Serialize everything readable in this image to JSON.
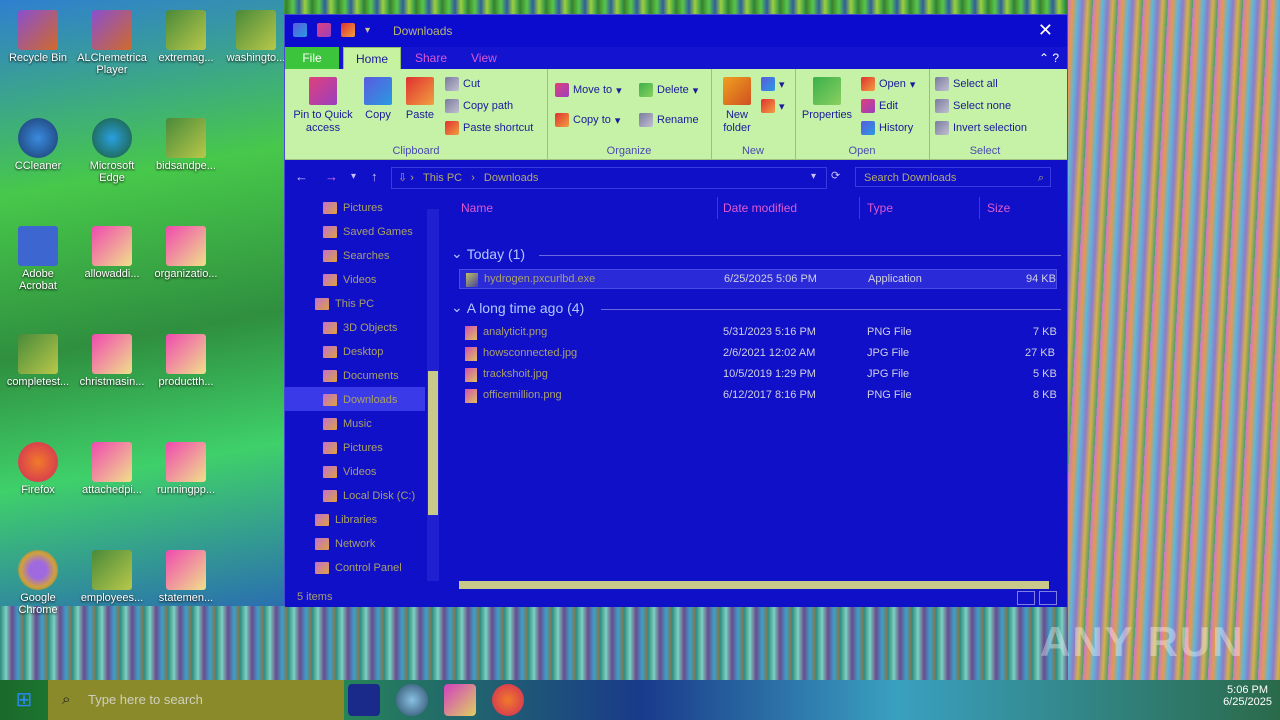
{
  "desktop": {
    "icons": [
      {
        "label": "Recycle Bin",
        "icon": "recycle-bin-icon"
      },
      {
        "label": "ALChemetrica Player",
        "icon": "app-icon"
      },
      {
        "label": "extremag...",
        "icon": "excel-file-icon"
      },
      {
        "label": "washingto...",
        "icon": "excel-file-icon"
      },
      {
        "label": "CCleaner",
        "icon": "ccleaner-icon"
      },
      {
        "label": "Microsoft Edge",
        "icon": "edge-icon"
      },
      {
        "label": "bidsandpe...",
        "icon": "excel-file-icon"
      },
      {
        "label": "Adobe Acrobat",
        "icon": "acrobat-icon"
      },
      {
        "label": "allowaddi...",
        "icon": "image-file-icon"
      },
      {
        "label": "organizatio...",
        "icon": "image-file-icon"
      },
      {
        "label": "completest...",
        "icon": "excel-file-icon"
      },
      {
        "label": "christmasin...",
        "icon": "image-file-icon"
      },
      {
        "label": "productth...",
        "icon": "image-file-icon"
      },
      {
        "label": "Firefox",
        "icon": "firefox-icon"
      },
      {
        "label": "attachedpi...",
        "icon": "image-file-icon"
      },
      {
        "label": "runningpp...",
        "icon": "image-file-icon"
      },
      {
        "label": "Google Chrome",
        "icon": "chrome-icon"
      },
      {
        "label": "employees...",
        "icon": "excel-file-icon"
      },
      {
        "label": "statemen...",
        "icon": "image-file-icon"
      }
    ],
    "watermark": "ANY RUN"
  },
  "window": {
    "title": "Downloads",
    "tabs": {
      "file": "File",
      "home": "Home",
      "share": "Share",
      "view": "View"
    },
    "ribbon": {
      "clipboard": {
        "label": "Clipboard",
        "pin": "Pin to Quick access",
        "copy": "Copy",
        "paste": "Paste",
        "cut": "Cut",
        "copy_path": "Copy path",
        "paste_shortcut": "Paste shortcut"
      },
      "organize": {
        "label": "Organize",
        "move_to": "Move to",
        "copy_to": "Copy to",
        "delete": "Delete",
        "rename": "Rename"
      },
      "new": {
        "label": "New",
        "new_folder": "New folder"
      },
      "open": {
        "label": "Open",
        "properties": "Properties",
        "open": "Open",
        "edit": "Edit",
        "history": "History"
      },
      "select": {
        "label": "Select",
        "select_all": "Select all",
        "select_none": "Select none",
        "invert": "Invert selection"
      }
    },
    "address": {
      "crumb1": "This PC",
      "crumb2": "Downloads",
      "search_placeholder": "Search Downloads"
    },
    "nav": [
      {
        "label": "Pictures"
      },
      {
        "label": "Saved Games"
      },
      {
        "label": "Searches"
      },
      {
        "label": "Videos"
      },
      {
        "label": "This PC"
      },
      {
        "label": "3D Objects"
      },
      {
        "label": "Desktop"
      },
      {
        "label": "Documents"
      },
      {
        "label": "Downloads"
      },
      {
        "label": "Music"
      },
      {
        "label": "Pictures"
      },
      {
        "label": "Videos"
      },
      {
        "label": "Local Disk (C:)"
      },
      {
        "label": "Libraries"
      },
      {
        "label": "Network"
      },
      {
        "label": "Control Panel"
      }
    ],
    "columns": {
      "name": "Name",
      "date": "Date modified",
      "type": "Type",
      "size": "Size"
    },
    "groups": {
      "today": "Today (1)",
      "long_ago": "A long time ago (4)"
    },
    "files": [
      {
        "name": "hydrogen.pxcurlbd.exe",
        "date": "6/25/2025 5:06 PM",
        "type": "Application",
        "size": "94 KB"
      },
      {
        "name": "analyticit.png",
        "date": "5/31/2023 5:16 PM",
        "type": "PNG File",
        "size": "7 KB"
      },
      {
        "name": "howsconnected.jpg",
        "date": "2/6/2021 12:02 AM",
        "type": "JPG File",
        "size": "27 KB"
      },
      {
        "name": "trackshoit.jpg",
        "date": "10/5/2019 1:29 PM",
        "type": "JPG File",
        "size": "5 KB"
      },
      {
        "name": "officemillion.png",
        "date": "6/12/2017 8:16 PM",
        "type": "PNG File",
        "size": "8 KB"
      }
    ],
    "status": "5 items"
  },
  "taskbar": {
    "search_placeholder": "Type here to search",
    "time": "5:06 PM",
    "date": "6/25/2025"
  }
}
